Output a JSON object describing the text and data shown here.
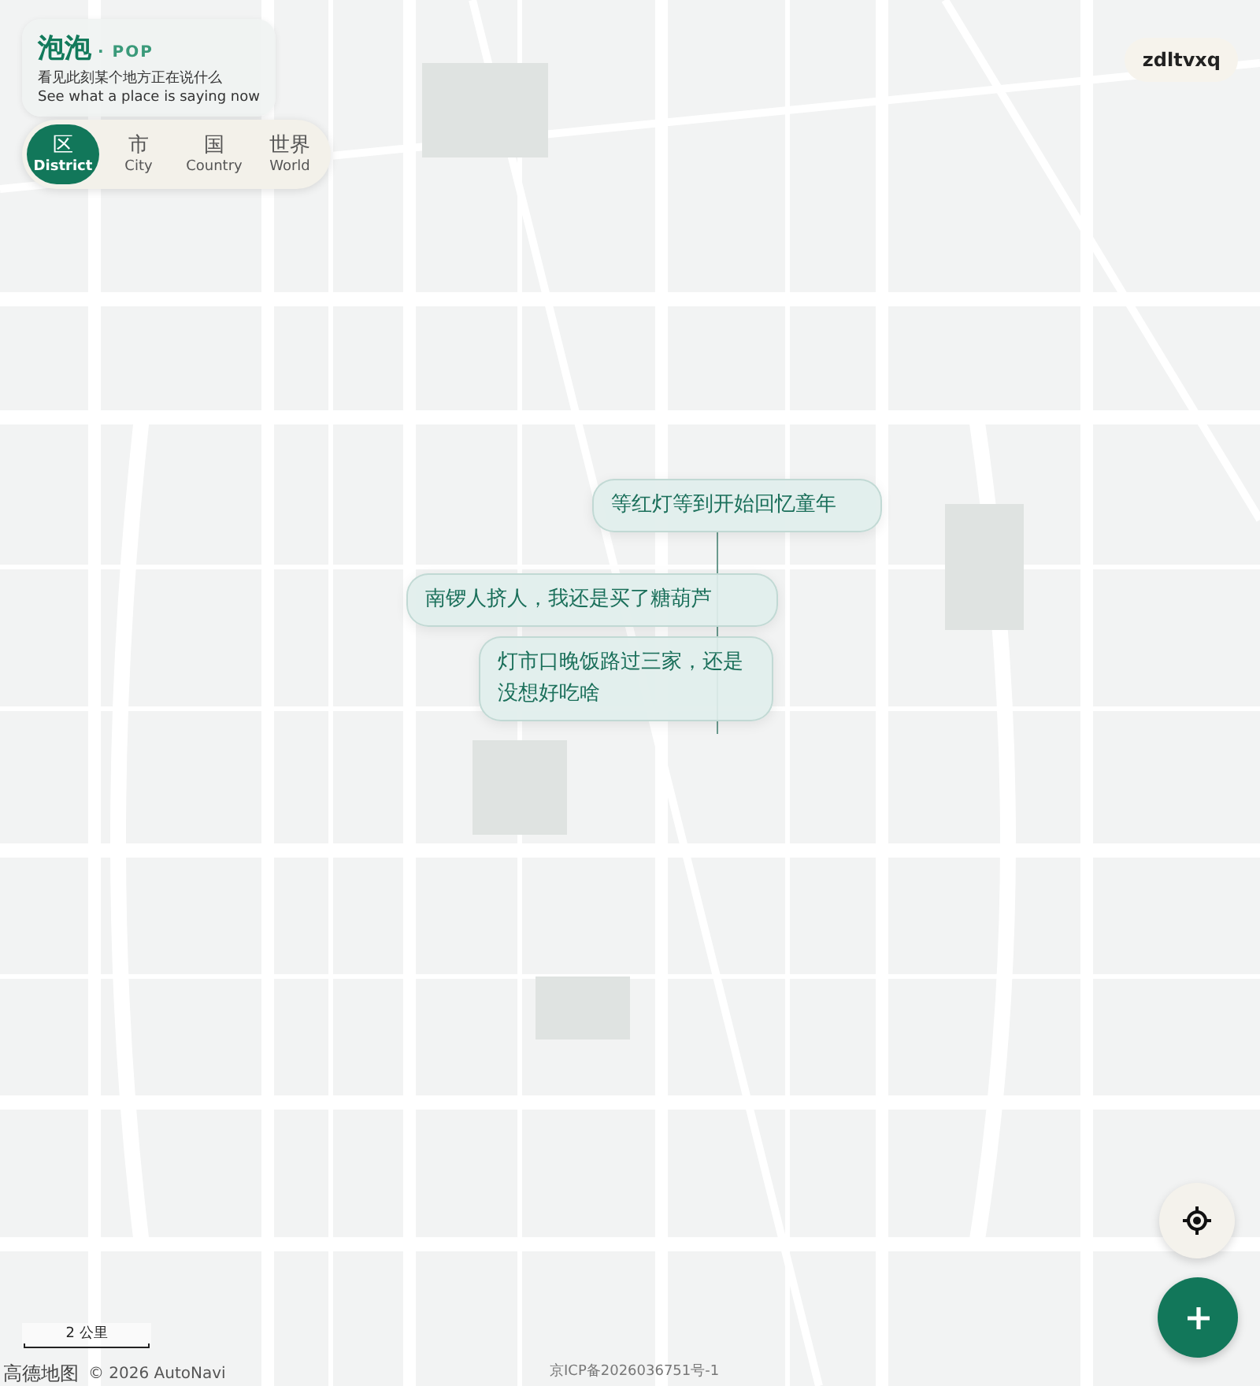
{
  "app": {
    "title": "泡泡",
    "tag": "· POP",
    "subtitle_zh": "看见此刻某个地方正在说什么",
    "subtitle_en": "See what a place is saying now"
  },
  "scopes": [
    {
      "label": "区",
      "sublabel": "District",
      "selected": true
    },
    {
      "label": "市",
      "sublabel": "City",
      "selected": false
    },
    {
      "label": "国",
      "sublabel": "Country",
      "selected": false
    },
    {
      "label": "世界",
      "sublabel": "World",
      "selected": false
    }
  ],
  "user": {
    "name": "zdltvxq"
  },
  "bubbles": [
    {
      "text": "等红灯等到开始回忆童年"
    },
    {
      "text": "南锣人挤人，我还是买了糖葫芦"
    },
    {
      "text": "灯市口晚饭路过三家，还是没想好吃啥"
    }
  ],
  "scale": {
    "label": "2 公里"
  },
  "attribution": {
    "logo": "高德地图",
    "copyright": "© 2026 AutoNavi",
    "icp": "京ICP备2026036751号-1"
  }
}
